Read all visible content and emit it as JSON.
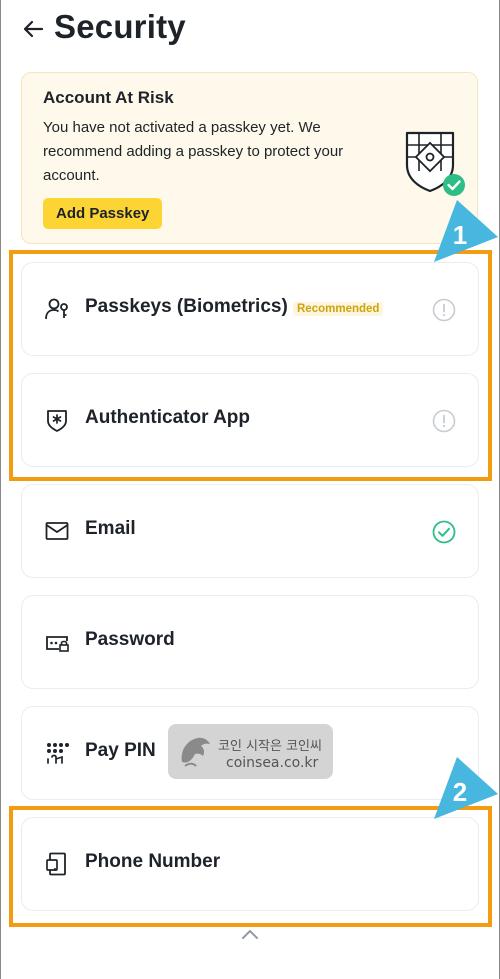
{
  "header": {
    "title": "Security"
  },
  "risk_banner": {
    "title": "Account At Risk",
    "message": "You have not activated a passkey yet. We recommend adding a passkey to protect your account.",
    "button_label": "Add Passkey"
  },
  "security_items": [
    {
      "label": "Passkeys (Biometrics)",
      "badge": "Recommended",
      "status": "warning",
      "icon": "passkey-icon"
    },
    {
      "label": "Authenticator App",
      "status": "warning",
      "icon": "authenticator-icon"
    },
    {
      "label": "Email",
      "status": "verified",
      "icon": "email-icon"
    },
    {
      "label": "Password",
      "icon": "password-icon"
    },
    {
      "label": "Pay PIN",
      "icon": "pin-icon"
    },
    {
      "label": "Phone Number",
      "icon": "phone-icon"
    }
  ],
  "annotations": [
    {
      "number": "1"
    },
    {
      "number": "2"
    }
  ],
  "watermark": {
    "line1": "코인 시작은 코인씨",
    "line2": "coinsea.co.kr"
  },
  "colors": {
    "accent": "#fcd535",
    "highlight": "#f39c12",
    "arrow": "#47b7e0",
    "success": "#2ebd85"
  }
}
